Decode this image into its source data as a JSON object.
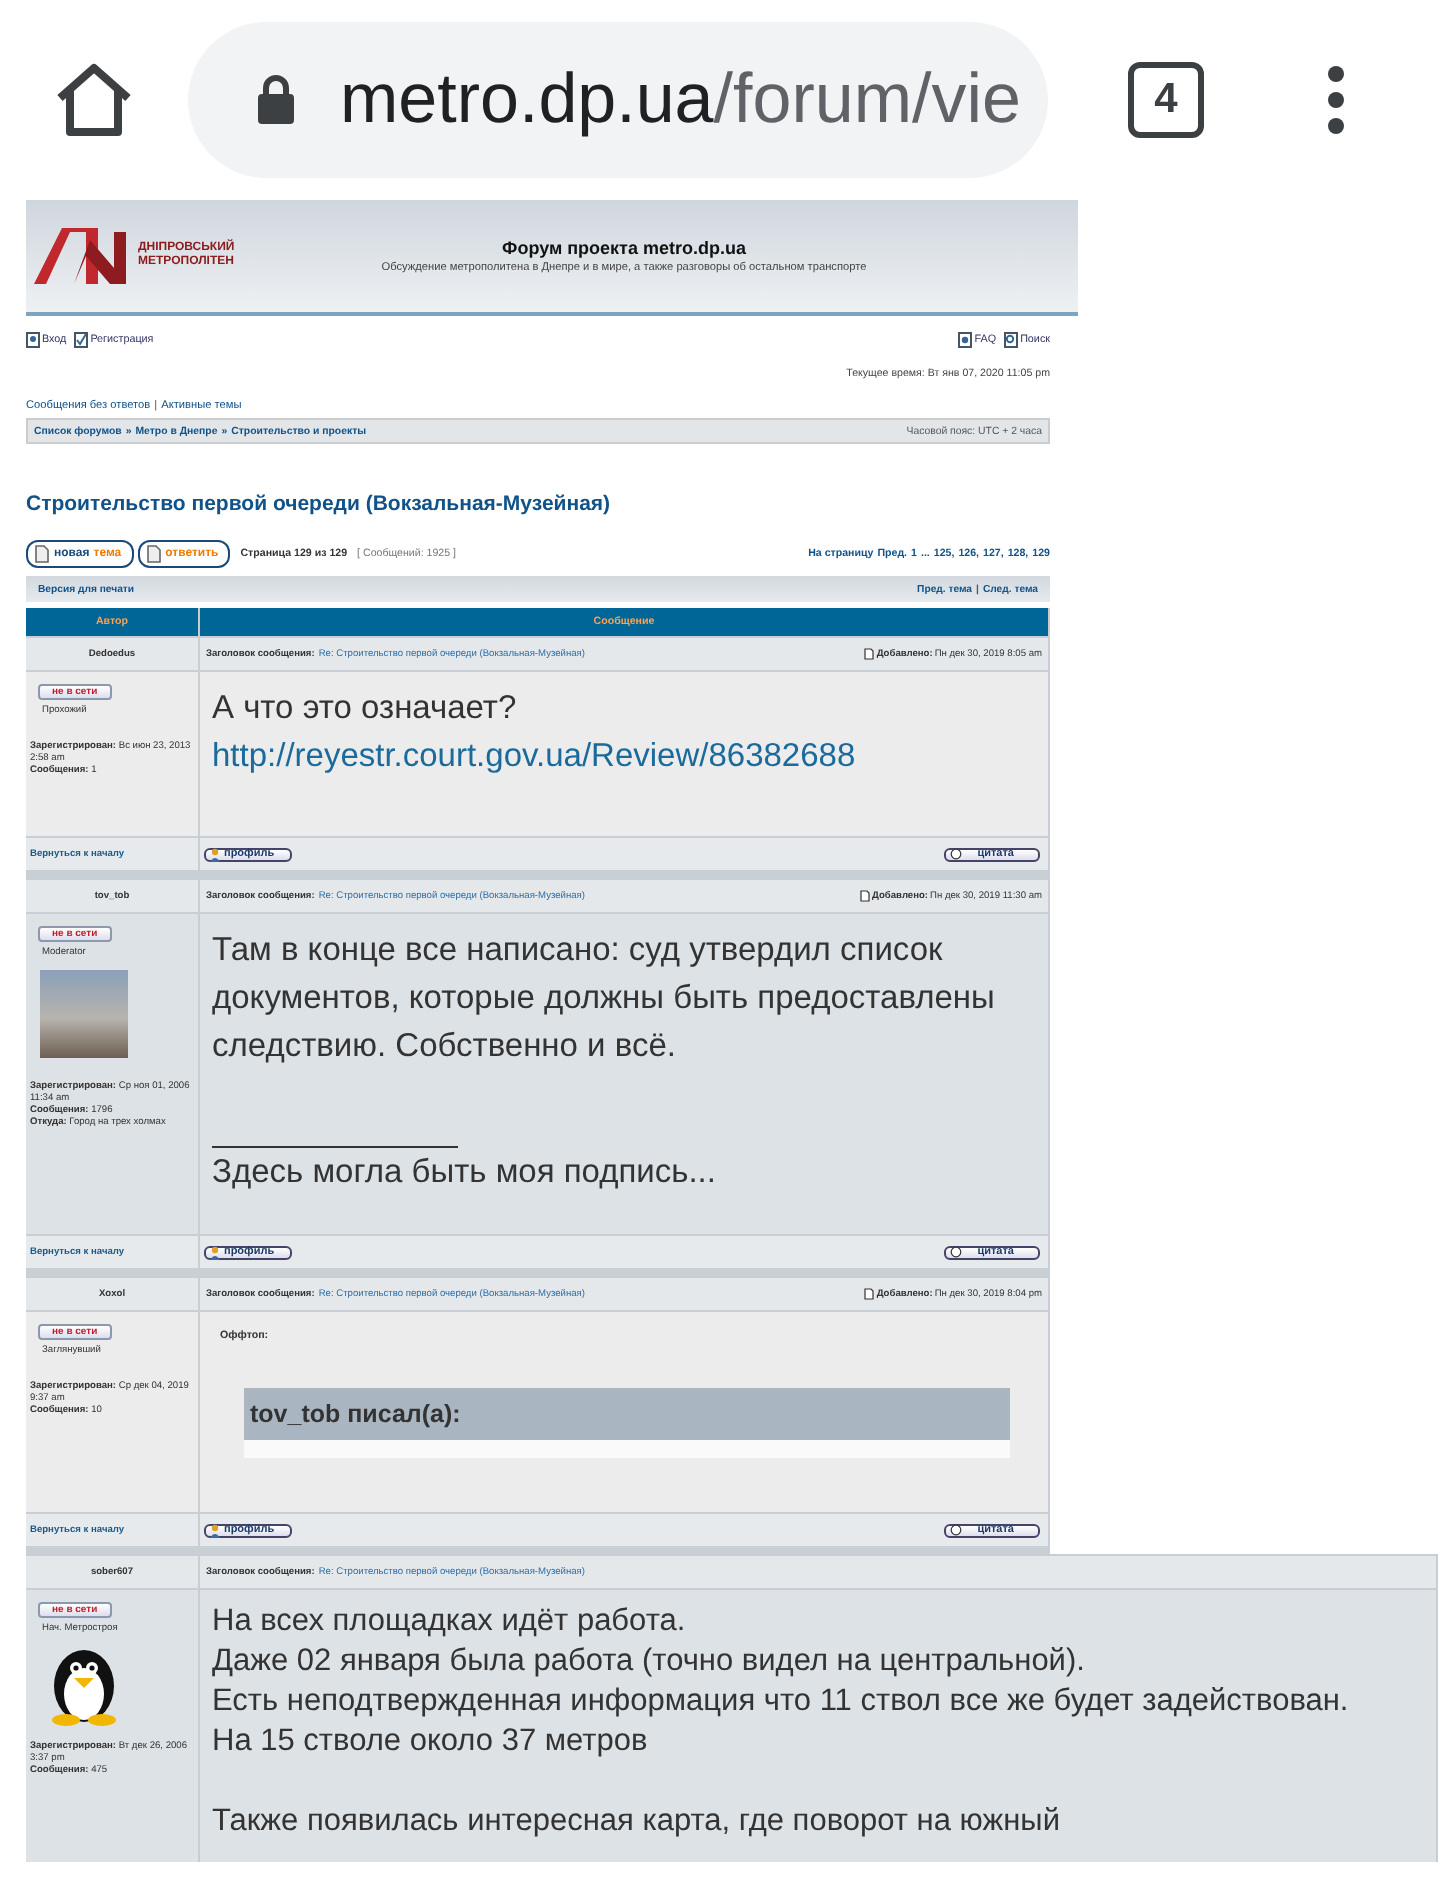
{
  "browser": {
    "url_host": "metro.dp.ua",
    "url_path": "/forum/vie",
    "tab_count": "4"
  },
  "header": {
    "logo_line_1": "ДНІПРОВСЬКИЙ",
    "logo_line_2": "МЕТРОПОЛІТЕН",
    "title": "Форум проекта metro.dp.ua",
    "subtitle": "Обсуждение метрополитена в Днепре и в мире, а также разговоры об остальном транспорте"
  },
  "nav_left": [
    {
      "kind": "login",
      "text": "Вход"
    },
    {
      "kind": "register",
      "text": "Регистрация"
    }
  ],
  "nav_right": [
    {
      "kind": "faq",
      "text": "FAQ"
    },
    {
      "kind": "search",
      "text": "Поиск"
    }
  ],
  "current_time": "Текущее время: Вт янв 07, 2020 11:05 pm",
  "quick_links": [
    "Сообщения без ответов",
    "Активные темы"
  ],
  "quick_links_separator": "|",
  "breadcrumb_separator": "»",
  "topic_nav_separator": "|",
  "breadcrumbs": [
    "Список форумов",
    "Метро в Днепре",
    "Строительство и проекты"
  ],
  "timezone": "Часовой пояс: UTC + 2 часа",
  "topic_title": "Строительство первой очереди (Вокзальная-Музейная)",
  "action_buttons": [
    {
      "kind": "new_topic",
      "word_1": "новая",
      "word_2": "тема"
    },
    {
      "kind": "reply",
      "word_1": "ответить"
    }
  ],
  "page_info": "Страница 129 из 129",
  "post_count": "[ Сообщений: 1925 ]",
  "pagination": {
    "label": "На страницу",
    "prev": "Пред.",
    "pages": [
      "1",
      "...",
      "125,",
      "126,",
      "127,",
      "128,",
      "129"
    ]
  },
  "print_link": "Версия для печати",
  "topic_nav": [
    "Пред. тема",
    "След. тема"
  ],
  "columns": [
    "Автор",
    "Сообщение"
  ],
  "posts": [
    {
      "author": "Dedoedus",
      "status": "не в сети",
      "rank": "Прохожий",
      "registered": "**Зарегистрирован:** Вс июн 23, 2013 2:58 am",
      "posts": "**Сообщения:** 1",
      "subject_label": "Заголовок сообщения:",
      "subject": "Re: Строительство первой очереди (Вокзальная-Музейная)",
      "posted_label": "Добавлено:",
      "posted": "Пн дек 30, 2019 8:05 am",
      "body": [
        {
          "kind": "paragraph",
          "lines": [
            "А что это означает?"
          ]
        },
        {
          "kind": "link",
          "text": "http://reyestr.court.gov.ua/Review/86382688"
        }
      ],
      "back_to_top": "Вернуться к началу",
      "profile": "профиль",
      "quote": "цитата"
    },
    {
      "author": "tov_tob",
      "status": "не в сети",
      "rank": "Moderator",
      "avatar": {
        "kind": "photo"
      },
      "registered": "**Зарегистрирован:** Ср ноя 01, 2006 11:34 am",
      "posts": "**Сообщения:** 1796",
      "location": "**Откуда:** Город на трех холмах",
      "subject_label": "Заголовок сообщения:",
      "subject": "Re: Строительство первой очереди (Вокзальная-Музейная)",
      "posted_label": "Добавлено:",
      "posted": "Пн дек 30, 2019 11:30 am",
      "body": [
        {
          "kind": "paragraph",
          "lines": [
            "Там в конце все написано: суд утвердил список документов, которые должны быть предоставлены следствию. Собственно и всё."
          ]
        },
        {
          "kind": "signature",
          "text": "Здесь могла быть моя подпись..."
        }
      ],
      "back_to_top": "Вернуться к началу",
      "profile": "профиль",
      "quote": "цитата"
    },
    {
      "author": "Xoxol",
      "status": "не в сети",
      "rank": "Заглянувший",
      "registered": "**Зарегистрирован:** Ср дек 04, 2019 9:37 am",
      "posts": "**Сообщения:** 10",
      "subject_label": "Заголовок сообщения:",
      "subject": "Re: Строительство первой очереди (Вокзальная-Музейная)",
      "posted_label": "Добавлено:",
      "posted": "Пн дек 30, 2019 8:04 pm",
      "body": [
        {
          "kind": "offtopic",
          "label": "Оффтоп:",
          "quote_author": "tov_tob писал(а):"
        }
      ],
      "back_to_top": "Вернуться к началу",
      "profile": "профиль",
      "quote": "цитата"
    },
    {
      "author": "sober607",
      "status": "не в сети",
      "rank": "Нач. Метростроя",
      "avatar": {
        "kind": "penguin"
      },
      "registered": "**Зарегистрирован:** Вт дек 26, 2006 3:37 pm",
      "posts": "**Сообщения:** 475",
      "subject_label": "Заголовок сообщения:",
      "subject": "Re: Строительство первой очереди (Вокзальная-Музейная)",
      "body": [
        {
          "kind": "paragraph",
          "lines": [
            "На всех площадках идёт работа.",
            "Даже 02 января была работа (точно видел на центральной).",
            "Есть неподтвержденная информация что 11 ствол все же будет задействован.",
            "На 15 стволе около 37 метров"
          ]
        },
        {
          "kind": "paragraph",
          "lines": [
            "Также появилась интересная карта, где поворот на южный"
          ]
        }
      ]
    }
  ]
}
